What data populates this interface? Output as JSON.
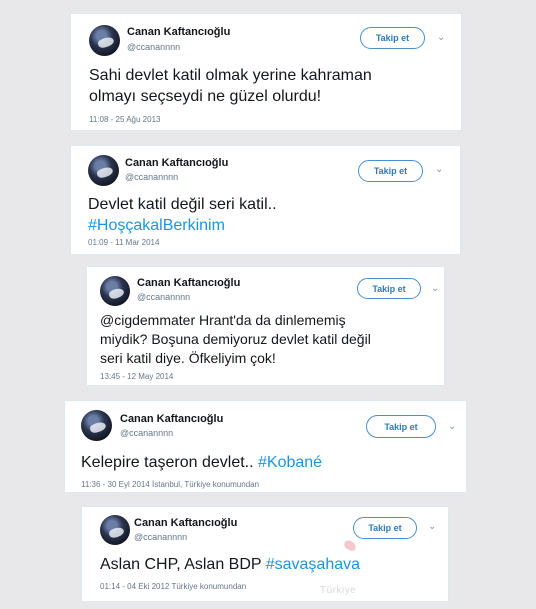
{
  "tweets": [
    {
      "name": "Canan Kaftancıoğlu",
      "handle": "@ccanannnn",
      "follow_label": "Takip et",
      "lines": [
        "Sahi devlet katil olmak yerine kahraman",
        "olmayı seçseydi ne güzel olurdu!"
      ],
      "hashtag": "",
      "meta": "11:08 - 25 Ağu 2013"
    },
    {
      "name": "Canan Kaftancıoğlu",
      "handle": "@ccanannnn",
      "follow_label": "Takip et",
      "lines": [
        "Devlet katil değil seri katil.."
      ],
      "hashtag": "#HoşçakalBerkinim",
      "meta": "01:09 - 11 Mar 2014"
    },
    {
      "name": "Canan Kaftancıoğlu",
      "handle": "@ccanannnn",
      "follow_label": "Takip et",
      "lines": [
        "@cigdemmater Hrant'da da dinlememiş",
        "miydik? Boşuna demiyoruz devlet katil değil",
        "seri katil diye. Öfkeliyim çok!"
      ],
      "hashtag": "",
      "meta": "13:45 - 12 May 2014"
    },
    {
      "name": "Canan Kaftancıoğlu",
      "handle": "@ccanannnn",
      "follow_label": "Takip et",
      "lines": [
        "Kelepire taşeron devlet.."
      ],
      "hashtag": "#Kobané",
      "meta": "11:36 - 30 Eyl 2014 İstanbul, Türkiye konumundan"
    },
    {
      "name": "Canan Kaftancıoğlu",
      "handle": "@ccanannnn",
      "follow_label": "Takip et",
      "lines": [
        "Aslan CHP, Aslan BDP"
      ],
      "hashtag": "#savaşahava",
      "meta": "01:14 - 04 Eki 2012 Türkiye konumundan"
    }
  ],
  "watermark": "Türkiye",
  "colors": {
    "hashtag": "#1b95e0",
    "follow_border": "#4a8fcf",
    "background": "#e8e8ea"
  },
  "icons": {
    "menu": "chevron-down-icon",
    "avatar": "avatar"
  }
}
